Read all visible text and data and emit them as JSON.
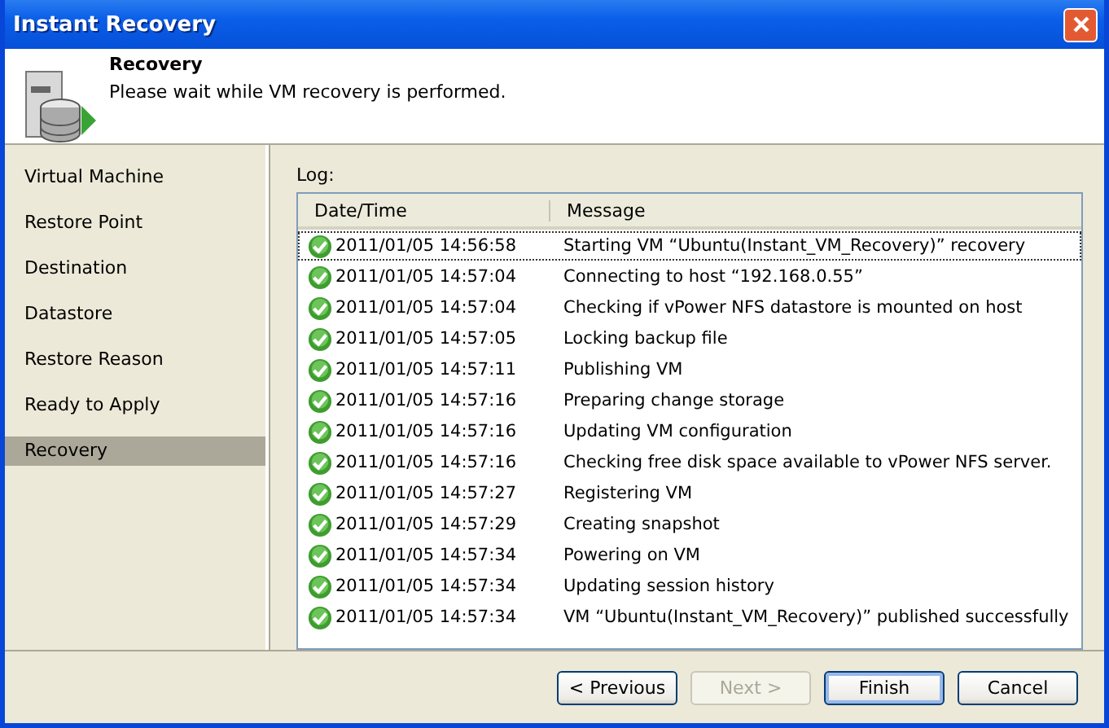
{
  "window": {
    "title": "Instant Recovery"
  },
  "header": {
    "title": "Recovery",
    "subtitle": "Please wait while VM recovery is performed."
  },
  "steps": [
    {
      "label": "Virtual Machine",
      "selected": false
    },
    {
      "label": "Restore Point",
      "selected": false
    },
    {
      "label": "Destination",
      "selected": false
    },
    {
      "label": "Datastore",
      "selected": false
    },
    {
      "label": "Restore Reason",
      "selected": false
    },
    {
      "label": "Ready to Apply",
      "selected": false
    },
    {
      "label": "Recovery",
      "selected": true
    }
  ],
  "log": {
    "label": "Log:",
    "columns": [
      "Date/Time",
      "Message"
    ],
    "rows": [
      {
        "time": "2011/01/05 14:56:58",
        "message": "Starting VM “Ubuntu(Instant_VM_Recovery)” recovery",
        "selected": true
      },
      {
        "time": "2011/01/05 14:57:04",
        "message": "Connecting to host “192.168.0.55”",
        "selected": false
      },
      {
        "time": "2011/01/05 14:57:04",
        "message": "Checking if vPower NFS datastore is mounted on host",
        "selected": false
      },
      {
        "time": "2011/01/05 14:57:05",
        "message": "Locking backup file",
        "selected": false
      },
      {
        "time": "2011/01/05 14:57:11",
        "message": "Publishing VM",
        "selected": false
      },
      {
        "time": "2011/01/05 14:57:16",
        "message": "Preparing change storage",
        "selected": false
      },
      {
        "time": "2011/01/05 14:57:16",
        "message": "Updating VM configuration",
        "selected": false
      },
      {
        "time": "2011/01/05 14:57:16",
        "message": "Checking free disk space available to vPower NFS server.",
        "selected": false
      },
      {
        "time": "2011/01/05 14:57:27",
        "message": "Registering VM",
        "selected": false
      },
      {
        "time": "2011/01/05 14:57:29",
        "message": "Creating snapshot",
        "selected": false
      },
      {
        "time": "2011/01/05 14:57:34",
        "message": "Powering on VM",
        "selected": false
      },
      {
        "time": "2011/01/05 14:57:34",
        "message": "Updating session history",
        "selected": false
      },
      {
        "time": "2011/01/05 14:57:34",
        "message": "VM “Ubuntu(Instant_VM_Recovery)” published successfully",
        "selected": false
      }
    ]
  },
  "buttons": [
    {
      "label": "< Previous",
      "disabled": false,
      "default": false
    },
    {
      "label": "Next >",
      "disabled": true,
      "default": false
    },
    {
      "label": "Finish",
      "disabled": false,
      "default": true
    },
    {
      "label": "Cancel",
      "disabled": false,
      "default": false
    }
  ]
}
